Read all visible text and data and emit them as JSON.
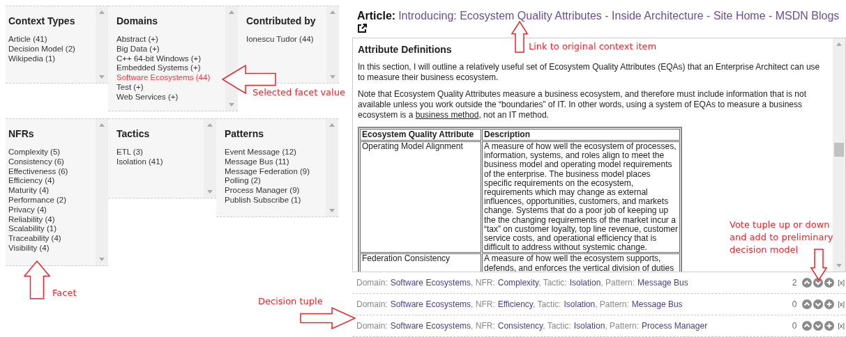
{
  "facet_rows": [
    [
      {
        "title": "Context Types",
        "items": [
          {
            "label": "Article (41)",
            "selected": false
          },
          {
            "label": "Decision Model (2)",
            "selected": false
          },
          {
            "label": "Wikipedia (1)",
            "selected": false
          }
        ]
      },
      {
        "title": "Domains",
        "items": [
          {
            "label": "Abstract (+)",
            "selected": false
          },
          {
            "label": "Big Data (+)",
            "selected": false
          },
          {
            "label": "C++ 64-bit Windows (+)",
            "selected": false
          },
          {
            "label": "Embedded Systems (+)",
            "selected": false
          },
          {
            "label": "Software Ecosystems (44)",
            "selected": true
          },
          {
            "label": "Test (+)",
            "selected": false
          },
          {
            "label": "Web Services (+)",
            "selected": false
          }
        ]
      },
      {
        "title": "Contributed by",
        "items": [
          {
            "label": "Ionescu Tudor (44)",
            "selected": false
          }
        ]
      }
    ],
    [
      {
        "title": "NFRs",
        "items": [
          {
            "label": "Complexity (5)",
            "selected": false
          },
          {
            "label": "Consistency (6)",
            "selected": false
          },
          {
            "label": "Effectiveness (6)",
            "selected": false
          },
          {
            "label": "Efficiency (4)",
            "selected": false
          },
          {
            "label": "Maturity (4)",
            "selected": false
          },
          {
            "label": "Performance (2)",
            "selected": false
          },
          {
            "label": "Privacy (4)",
            "selected": false
          },
          {
            "label": "Reliability (4)",
            "selected": false
          },
          {
            "label": "Scalability (1)",
            "selected": false
          },
          {
            "label": "Traceability (4)",
            "selected": false
          },
          {
            "label": "Visibility (4)",
            "selected": false
          }
        ]
      },
      {
        "title": "Tactics",
        "items": [
          {
            "label": "ETL (3)",
            "selected": false
          },
          {
            "label": "Isolation (41)",
            "selected": false
          }
        ]
      },
      {
        "title": "Patterns",
        "items": [
          {
            "label": "Event Message (12)",
            "selected": false
          },
          {
            "label": "Message Bus (11)",
            "selected": false
          },
          {
            "label": "Message Federation (9)",
            "selected": false
          },
          {
            "label": "Polling (2)",
            "selected": false
          },
          {
            "label": "Process Manager (9)",
            "selected": false
          },
          {
            "label": "Publish Subscribe (1)",
            "selected": false
          }
        ]
      }
    ]
  ],
  "article": {
    "label": "Article:",
    "title": "Introducing: Ecosystem Quality Attributes - Inside Architecture - Site Home - MSDN Blogs",
    "heading": "Attribute Definitions",
    "paragraphs": [
      {
        "text": "In this section, I will outline a relatively useful set of Ecosystem Quality Attributes (EQAs) that an Enterprise Architect can use to measure their business ecosystem."
      },
      {
        "text": "Note that Ecosystem Quality Attributes measure a business ecosystem, and therefore must include information that is not available unless you work outside the “boundaries” of IT.  In other words, using a system of EQAs to measure a business ecosystem is a ",
        "link": "business method",
        "after": ", not an IT method."
      }
    ],
    "table": {
      "columns": [
        "Ecosystem Quality Attribute",
        "Description"
      ],
      "rows": [
        [
          "Operating Model Alignment",
          "A measure of how well the ecosystem of processes, information, systems, and roles align to meet the business model and operating model requirements of the enterprise.  The business model places specific requirements on the ecosystem, requirements which may change as external influences, opportunities, customers, and markets change.  Systems that do a poor job of keeping up the the changing requirements of the market incur a “tax” on customer loyalty, top line revenue, customer service costs, and operational efficiency that is difficult to address without systemic change."
        ],
        [
          "Federation Consistency",
          "A measure of how well the ecosystem supports, defends, and enforces the vertical division of duties"
        ]
      ]
    }
  },
  "tuples": [
    {
      "parts": [
        {
          "label": "Domain:",
          "value": "Software Ecosystems"
        },
        {
          "label": ", NFR:",
          "value": "Complexity"
        },
        {
          "label": ", Tactic:",
          "value": "Isolation"
        },
        {
          "label": ", Pattern:",
          "value": "Message Bus"
        }
      ],
      "count": "2",
      "remove": "[x]"
    },
    {
      "parts": [
        {
          "label": "Domain:",
          "value": "Software Ecosystems"
        },
        {
          "label": ", NFR:",
          "value": "Efficiency"
        },
        {
          "label": ", Tactic:",
          "value": "Isolation"
        },
        {
          "label": ", Pattern:",
          "value": "Message Bus"
        }
      ],
      "count": "0",
      "remove": "[x]"
    },
    {
      "parts": [
        {
          "label": "Domain:",
          "value": "Software Ecosystems"
        },
        {
          "label": ", NFR:",
          "value": "Consistency"
        },
        {
          "label": ", Tactic:",
          "value": "Isolation"
        },
        {
          "label": ", Pattern:",
          "value": "Process Manager"
        }
      ],
      "count": "0",
      "remove": "[x]"
    }
  ],
  "annotations": [
    {
      "kind": "left",
      "text": "Selected facet value"
    },
    {
      "kind": "up",
      "text": "Link to original context item"
    },
    {
      "kind": "up",
      "text": "Facet"
    },
    {
      "kind": "right",
      "text": "Decision tuple"
    },
    {
      "kind": "down",
      "text": "Vote tuple up or down and add to preliminary decision model"
    }
  ]
}
